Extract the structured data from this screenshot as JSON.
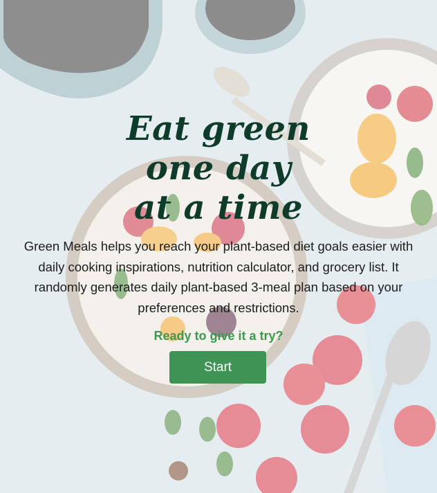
{
  "hero": {
    "headline": [
      "Eat green",
      "one day",
      "at a time"
    ],
    "description": [
      "Green Meals helps you reach your plant-based diet goals easier with",
      "daily cooking inspirations, nutrition calculator, and grocery list. It",
      "randomly generates daily plant-based 3-meal plan based on your",
      "preferences and restrictions."
    ],
    "cta_prompt": "Ready to give it a try?",
    "start_button_label": "Start",
    "background_image": "breakfast-bowls-with-strawberries-photo"
  },
  "colors": {
    "headline": "#0f3b2a",
    "cta_prompt": "#3b9a4f",
    "button_bg": "#3f9354",
    "button_text": "#ffffff",
    "overlay": "rgba(255,255,255,0.42)"
  }
}
